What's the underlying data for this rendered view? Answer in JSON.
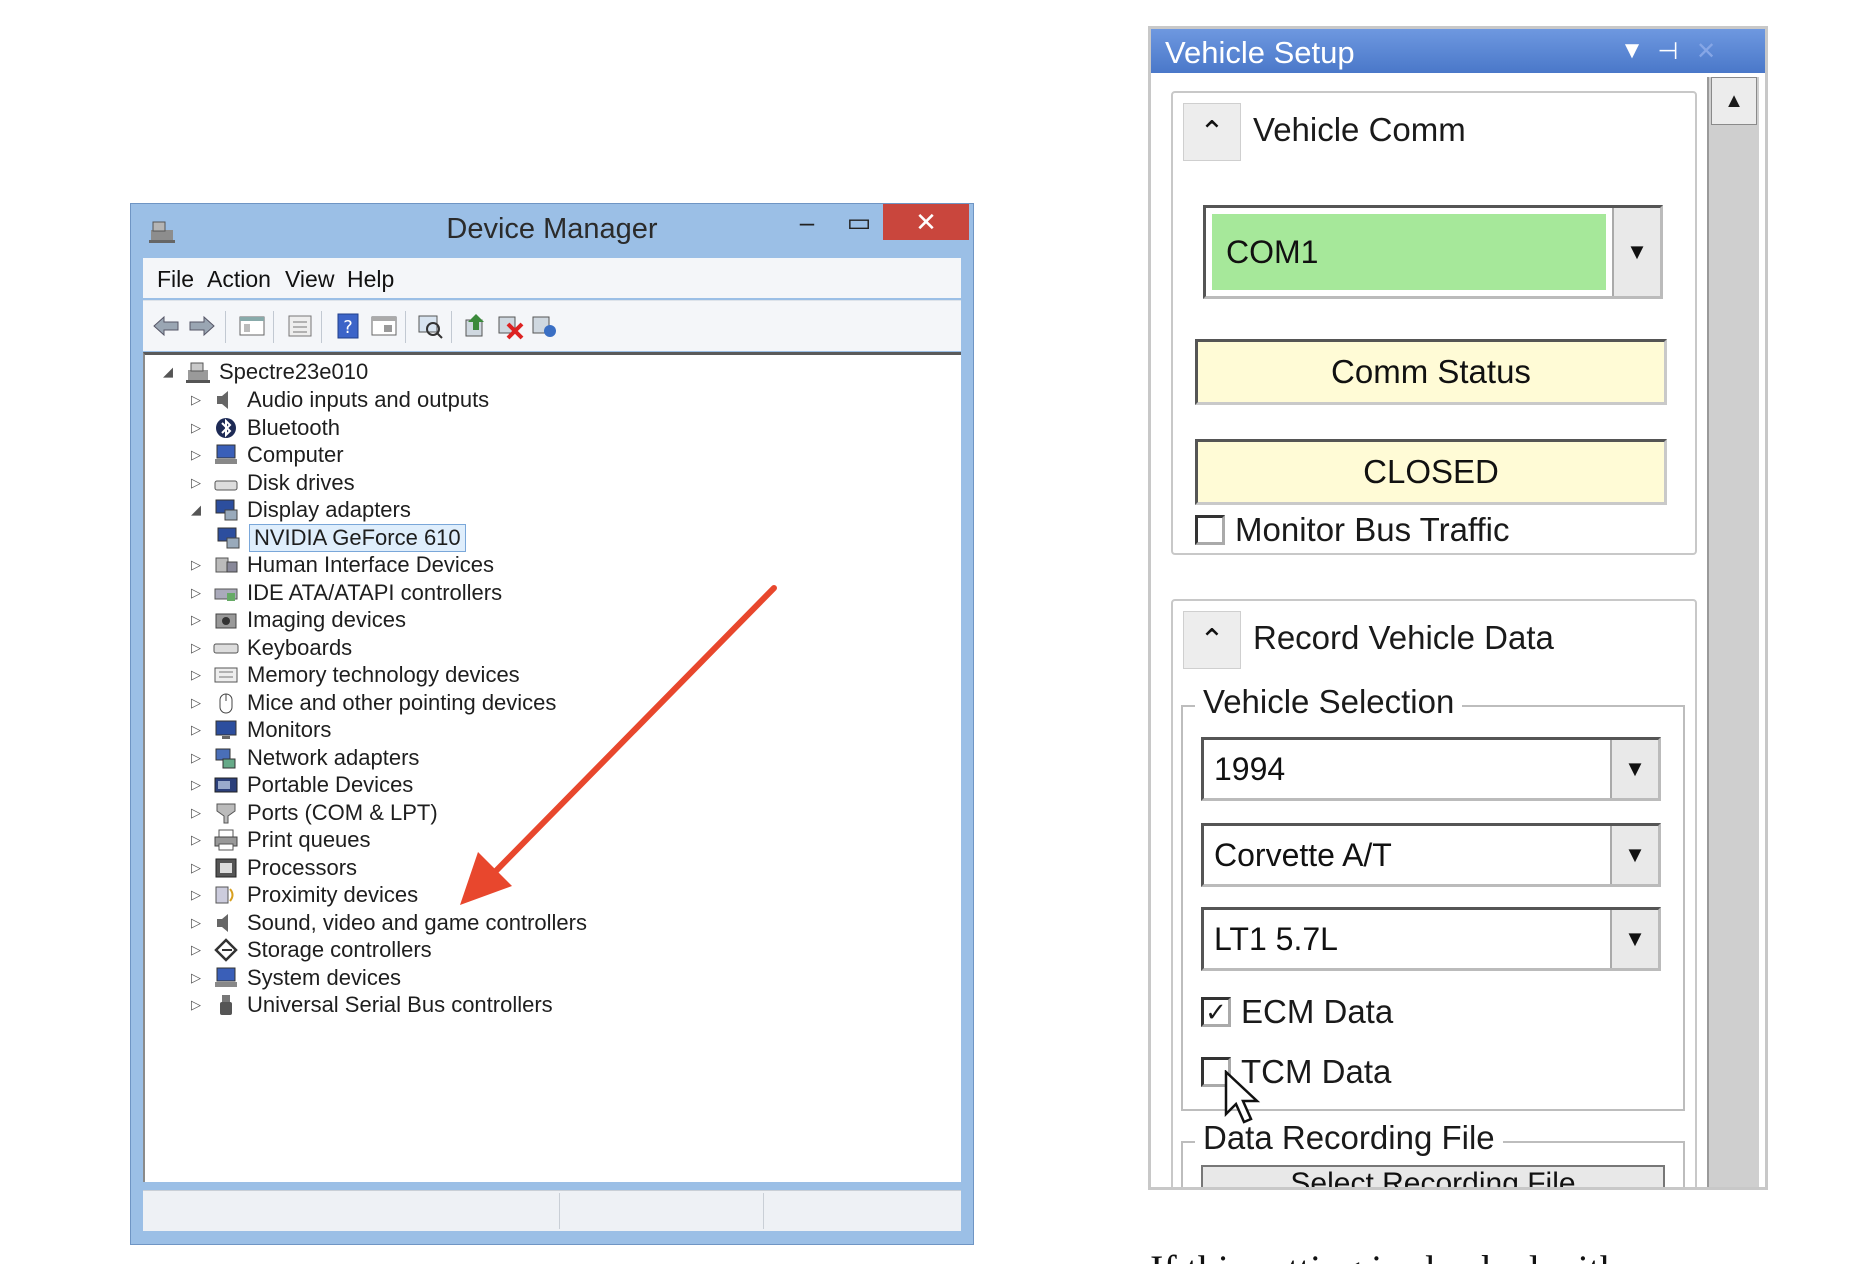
{
  "device_manager": {
    "title": "Device Manager",
    "window_buttons": {
      "minimize": "–",
      "maximize": "▭",
      "close": "✕"
    },
    "menu": [
      "File",
      "Action",
      "View",
      "Help"
    ],
    "root": "Spectre23e010",
    "tree": [
      {
        "label": "Audio inputs and outputs",
        "icon": "speaker-icon",
        "expander": "▷"
      },
      {
        "label": "Bluetooth",
        "icon": "bluetooth-icon",
        "expander": "▷"
      },
      {
        "label": "Computer",
        "icon": "computer-icon",
        "expander": "▷"
      },
      {
        "label": "Disk drives",
        "icon": "disk-drive-icon",
        "expander": "▷"
      },
      {
        "label": "Display adapters",
        "icon": "display-adapter-icon",
        "expander": "◢"
      },
      {
        "label": "NVIDIA GeForce 610",
        "icon": "display-adapter-icon",
        "expander": "",
        "child": true,
        "selected": true
      },
      {
        "label": "Human Interface Devices",
        "icon": "hid-icon",
        "expander": "▷"
      },
      {
        "label": "IDE ATA/ATAPI controllers",
        "icon": "ide-controller-icon",
        "expander": "▷"
      },
      {
        "label": "Imaging devices",
        "icon": "camera-icon",
        "expander": "▷"
      },
      {
        "label": "Keyboards",
        "icon": "keyboard-icon",
        "expander": "▷"
      },
      {
        "label": "Memory technology devices",
        "icon": "memory-icon",
        "expander": "▷"
      },
      {
        "label": "Mice and other pointing devices",
        "icon": "mouse-icon",
        "expander": "▷"
      },
      {
        "label": "Monitors",
        "icon": "monitor-icon",
        "expander": "▷"
      },
      {
        "label": "Network adapters",
        "icon": "network-icon",
        "expander": "▷"
      },
      {
        "label": "Portable Devices",
        "icon": "portable-device-icon",
        "expander": "▷"
      },
      {
        "label": "Ports (COM & LPT)",
        "icon": "port-icon",
        "expander": "▷"
      },
      {
        "label": "Print queues",
        "icon": "printer-icon",
        "expander": "▷"
      },
      {
        "label": "Processors",
        "icon": "processor-icon",
        "expander": "▷"
      },
      {
        "label": "Proximity devices",
        "icon": "proximity-icon",
        "expander": "▷"
      },
      {
        "label": "Sound, video and game controllers",
        "icon": "speaker-icon",
        "expander": "▷"
      },
      {
        "label": "Storage controllers",
        "icon": "storage-icon",
        "expander": "▷"
      },
      {
        "label": "System devices",
        "icon": "computer-icon",
        "expander": "▷"
      },
      {
        "label": "Universal Serial Bus controllers",
        "icon": "usb-icon",
        "expander": "▷"
      }
    ],
    "colors": {
      "frame": "#9bbfe6",
      "close": "#c9463d",
      "arrow": "#e8472d"
    }
  },
  "vehicle_setup": {
    "title": "Vehicle Setup",
    "vehicle_comm": {
      "title": "Vehicle Comm",
      "port": "COM1",
      "status_label": "Comm Status",
      "status_value": "CLOSED",
      "monitor_bus_traffic": {
        "label": "Monitor Bus Traffic",
        "checked": false
      }
    },
    "record": {
      "title": "Record Vehicle Data",
      "selection_legend": "Vehicle Selection",
      "year": "1994",
      "model": "Corvette A/T",
      "engine": "LT1 5.7L",
      "ecm": {
        "label": "ECM Data",
        "checked": true
      },
      "tcm": {
        "label": "TCM Data",
        "checked": false
      },
      "file_legend": "Data Recording File",
      "select_file_button": "Select Recording File"
    },
    "colors": {
      "com_port_bg": "#a6e89a",
      "status_bg": "#fffbd6",
      "title_bar": "#5a86d4"
    }
  },
  "caption_fragment": "If this setting is checked with"
}
